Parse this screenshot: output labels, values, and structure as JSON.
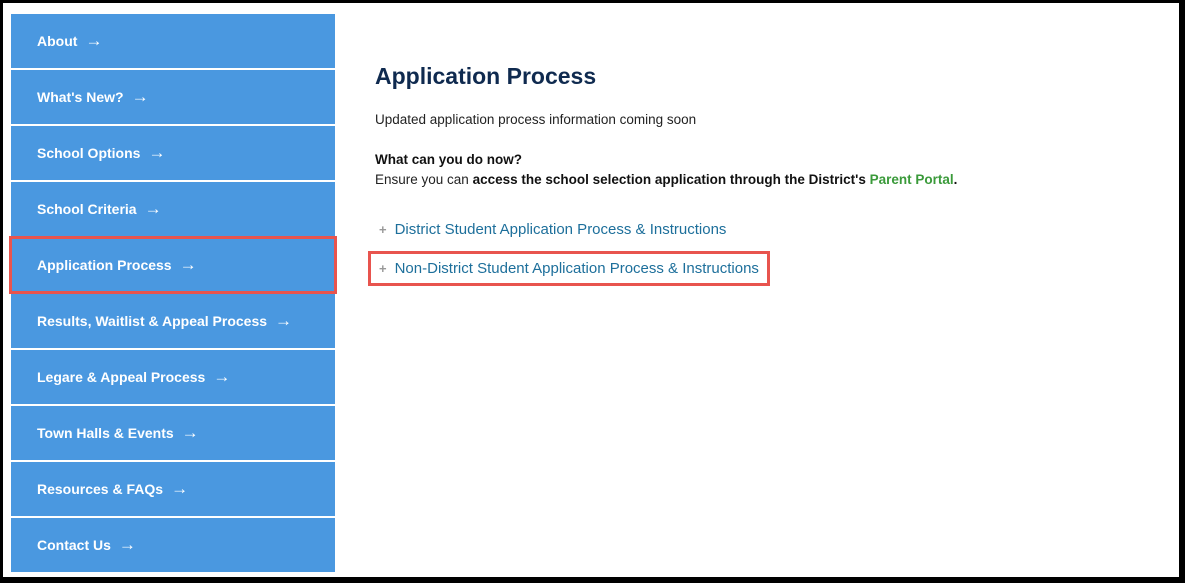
{
  "sidebar": {
    "items": [
      {
        "label": "About",
        "arrow": "→"
      },
      {
        "label": "What's New?",
        "arrow": "→"
      },
      {
        "label": "School Options",
        "arrow": "→"
      },
      {
        "label": "School Criteria",
        "arrow": "→"
      },
      {
        "label": "Application Process",
        "arrow": "→"
      },
      {
        "label": "Results, Waitlist & Appeal Process",
        "arrow": "→"
      },
      {
        "label": "Legare & Appeal Process",
        "arrow": "→"
      },
      {
        "label": "Town Halls & Events",
        "arrow": "→"
      },
      {
        "label": "Resources & FAQs",
        "arrow": "→"
      },
      {
        "label": "Contact Us",
        "arrow": "→"
      }
    ]
  },
  "main": {
    "title": "Application Process",
    "update_text": "Updated application process information coming soon",
    "what_now": "What can you do now?",
    "ensure_prefix": "Ensure you can ",
    "ensure_bold": "access the school selection application through the District's ",
    "portal_link": "Parent Portal",
    "ensure_suffix": ".",
    "accordion": [
      {
        "icon": "+",
        "label": "District Student Application Process & Instructions"
      },
      {
        "icon": "+",
        "label": "Non-District Student Application Process & Instructions"
      }
    ]
  },
  "colors": {
    "sidebar_bg": "#4a98e0",
    "title": "#0f2a4f",
    "link": "#1d6f9b",
    "portal_link": "#3a9a3a",
    "highlight": "#e8544e"
  }
}
